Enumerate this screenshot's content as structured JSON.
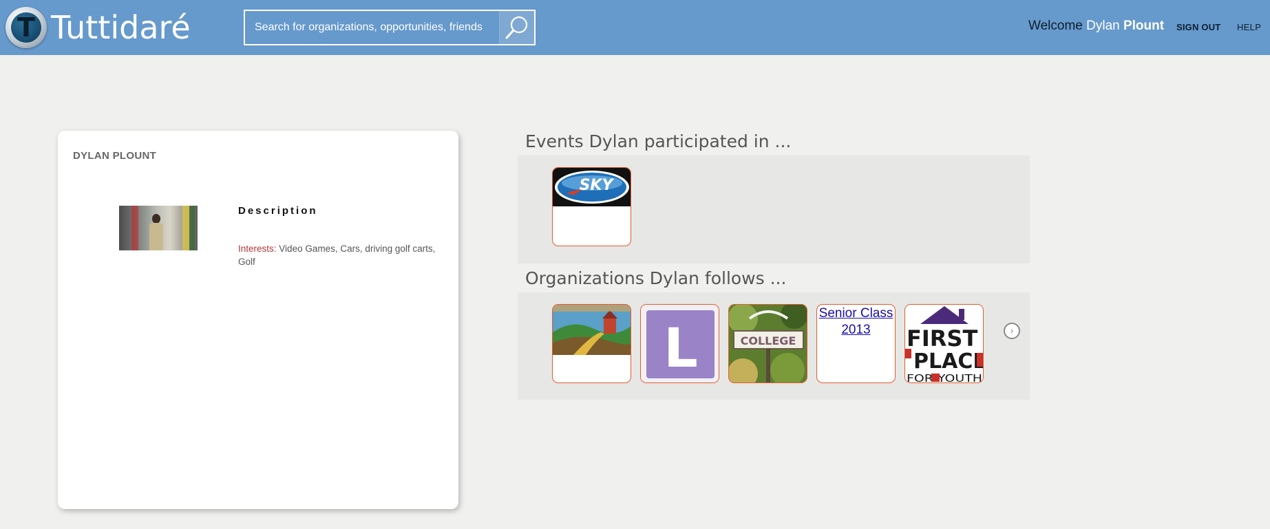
{
  "header": {
    "logo_text": "Tuttidaré",
    "logo_letter": "T",
    "search_placeholder": "Search for organizations, opportunities, friends",
    "welcome_label": "Welcome",
    "user_first": "Dylan",
    "user_last": "Plount",
    "sign_out": "SIGN OUT",
    "help": "HELP"
  },
  "profile": {
    "name": "DYLAN PLOUNT",
    "description_title": "Description",
    "interests_label": "Interests:",
    "interests_value": "Video Games, Cars, driving golf carts, Golf"
  },
  "events": {
    "title": "Events Dylan participated in ...",
    "items": [
      {
        "logo_text": "SKY"
      }
    ]
  },
  "organizations": {
    "title": "Organizations Dylan follows ...",
    "items": [
      {
        "kind": "painting"
      },
      {
        "kind": "letter",
        "letter": "L"
      },
      {
        "kind": "college",
        "sign": "COLLEGE"
      },
      {
        "kind": "link",
        "label": "Senior Class 2013"
      },
      {
        "kind": "firstplace",
        "line1": "FIRST",
        "line2": "PLACE",
        "line3": "FOR YOUTH"
      }
    ]
  },
  "colors": {
    "header_bg": "#6699cc",
    "tile_border": "#e35b2c",
    "interest_label": "#b03838"
  }
}
